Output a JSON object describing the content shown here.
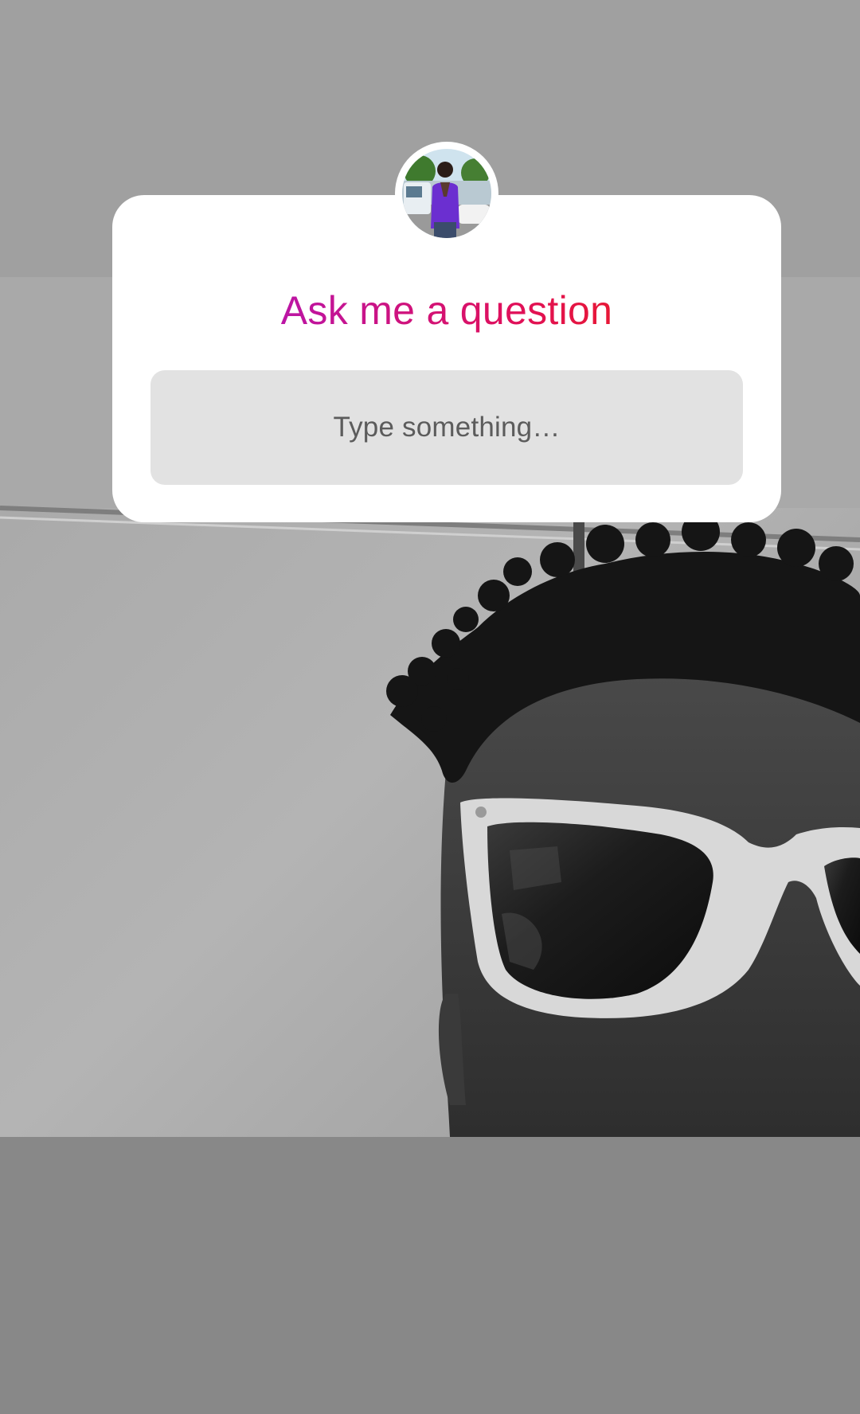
{
  "sticker": {
    "title": "Ask me a question",
    "input_placeholder": "Type something…"
  },
  "colors": {
    "title_gradient_start": "#b616b0",
    "title_gradient_end": "#ec1c1c",
    "sticker_background": "#ffffff",
    "input_background": "#e2e2e2"
  }
}
